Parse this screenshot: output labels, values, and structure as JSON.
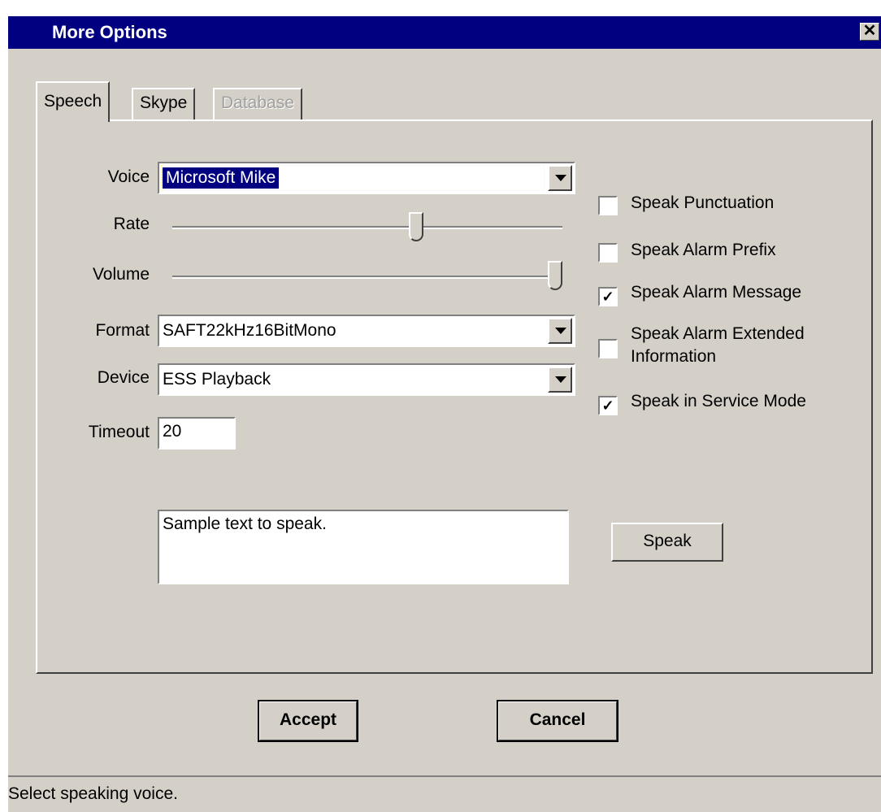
{
  "window": {
    "title": "More Options",
    "close_glyph": "✕"
  },
  "tabs": [
    {
      "label": "Speech",
      "state": "active"
    },
    {
      "label": "Skype",
      "state": "normal"
    },
    {
      "label": "Database",
      "state": "disabled"
    }
  ],
  "speech": {
    "voice": {
      "label": "Voice",
      "value": "Microsoft Mike"
    },
    "rate": {
      "label": "Rate",
      "level": 0.63
    },
    "volume": {
      "label": "Volume",
      "level": 1.0
    },
    "format": {
      "label": "Format",
      "value": "SAFT22kHz16BitMono"
    },
    "device": {
      "label": "Device",
      "value": "ESS Playback"
    },
    "timeout": {
      "label": "Timeout",
      "value": "20"
    },
    "checkboxes": [
      {
        "label": "Speak Punctuation",
        "checked": false
      },
      {
        "label": "Speak Alarm Prefix",
        "checked": false
      },
      {
        "label": "Speak Alarm Message",
        "checked": true
      },
      {
        "label": "Speak Alarm Extended Information",
        "checked": false
      },
      {
        "label": "Speak in Service Mode",
        "checked": true
      }
    ],
    "sample_text": "Sample text to speak.",
    "speak_button": "Speak"
  },
  "footer": {
    "accept_label": "Accept",
    "cancel_label": "Cancel"
  },
  "status": {
    "text": "Select speaking voice."
  },
  "check_glyph": "✓",
  "colors": {
    "titlebar": "#000080",
    "face": "#d4d0c8",
    "selection": "#000080"
  }
}
